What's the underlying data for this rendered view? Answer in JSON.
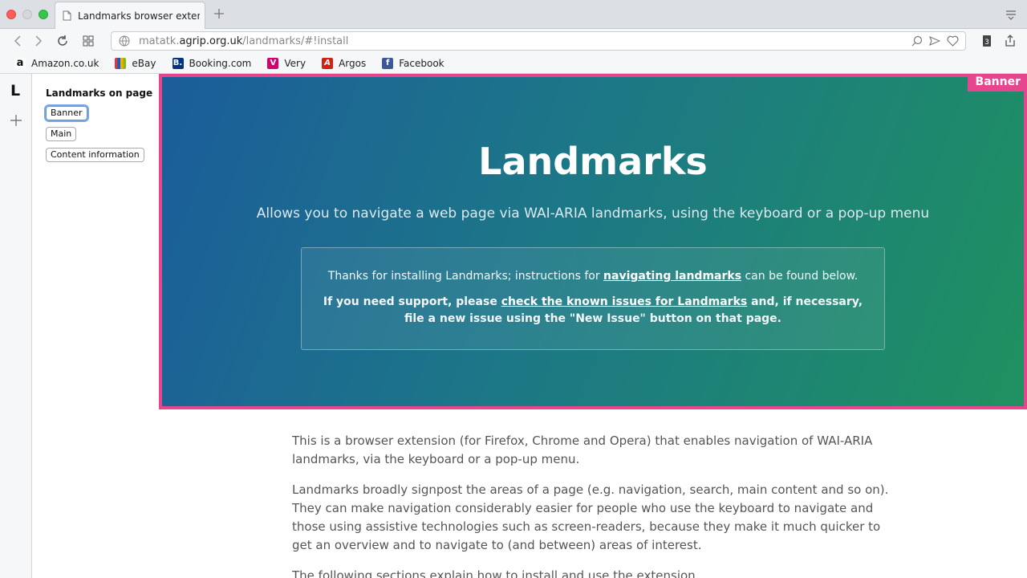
{
  "browser": {
    "tab_title": "Landmarks browser extension",
    "url_domain_prefix": "matatk.",
    "url_domain": "agrip.org.uk",
    "url_path": "/landmarks/#!install",
    "bookmarks": [
      {
        "label": "Amazon.co.uk",
        "icon": "amazon-icon",
        "color": "#111111"
      },
      {
        "label": "eBay",
        "icon": "ebay-icon",
        "color": "#e53238"
      },
      {
        "label": "Booking.com",
        "icon": "booking-icon",
        "color": "#003580"
      },
      {
        "label": "Very",
        "icon": "very-icon",
        "color": "#d6006d"
      },
      {
        "label": "Argos",
        "icon": "argos-icon",
        "color": "#d42114"
      },
      {
        "label": "Facebook",
        "icon": "facebook-icon",
        "color": "#3b5998"
      }
    ]
  },
  "sidebar": {
    "logo_letter": "L"
  },
  "panel": {
    "title": "Landmarks on page",
    "landmarks": [
      "Banner",
      "Main",
      "Content information"
    ]
  },
  "banner": {
    "tag": "Banner",
    "title": "Landmarks",
    "subtitle": "Allows you to navigate a web page via WAI-ARIA landmarks, using the keyboard or a pop-up menu",
    "notice_1_pre": "Thanks for installing Landmarks; instructions for ",
    "notice_1_link": "navigating landmarks",
    "notice_1_post": " can be found below.",
    "notice_2_pre": "If you need support, please ",
    "notice_2_link": "check the known issues for Landmarks",
    "notice_2_post": " and, if necessary, file a new issue using the \"New Issue\" button on that page.",
    "highlight_color": "#e8458f"
  },
  "main": {
    "para1": "This is a browser extension (for Firefox, Chrome and Opera) that enables navigation of WAI-ARIA landmarks, via the keyboard or a pop-up menu.",
    "para2": "Landmarks broadly signpost the areas of a page (e.g. navigation, search, main content and so on). They can make navigation considerably easier for people who use the keyboard to navigate and those using assistive technologies such as screen-readers, because they make it much quicker to get an overview and to navigate to (and between) areas of interest.",
    "para3": "The following sections explain how to install and use the extension."
  }
}
